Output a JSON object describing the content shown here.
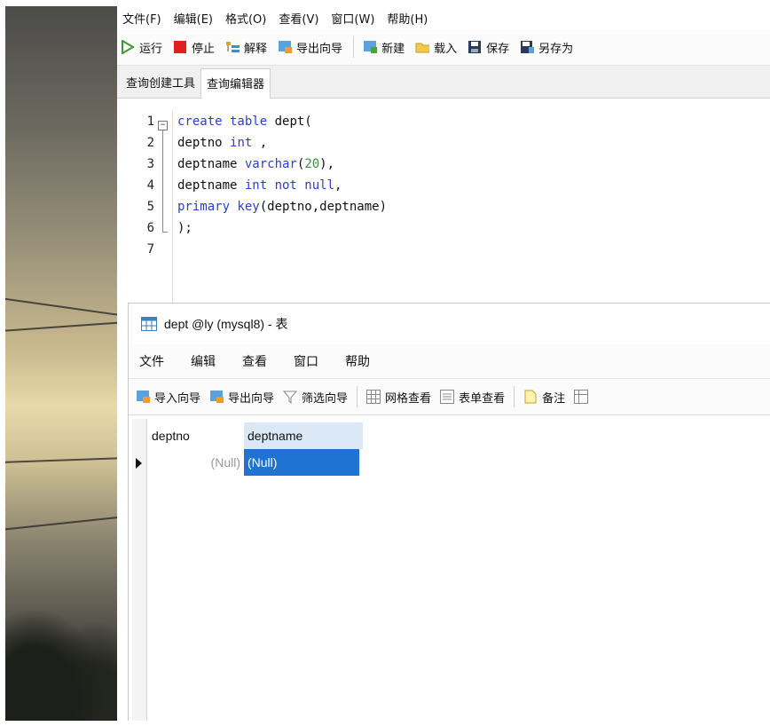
{
  "menubar": [
    "文件(F)",
    "编辑(E)",
    "格式(O)",
    "查看(V)",
    "窗口(W)",
    "帮助(H)"
  ],
  "toolbar": {
    "run": "运行",
    "stop": "停止",
    "explain": "解释",
    "export": "导出向导",
    "new": "新建",
    "load": "载入",
    "save": "保存",
    "save_as": "另存为"
  },
  "tabs": [
    "查询创建工具",
    "查询编辑器"
  ],
  "editor": {
    "line_numbers": [
      "1",
      "2",
      "3",
      "4",
      "5",
      "6",
      "7"
    ],
    "lines": [
      {
        "a": "create table",
        "b": " dept("
      },
      {
        "a": "deptno ",
        "k": "int",
        "b": " ,"
      },
      {
        "a": "deptname ",
        "k": "varchar",
        "b": "(",
        "n": "20",
        "c": "),"
      },
      {
        "a": "deptname ",
        "k": "int not null",
        "b": ","
      },
      {
        "k": "primary key",
        "b": "(deptno,deptname)"
      },
      {
        "b": ");"
      }
    ]
  },
  "table_window": {
    "title": "dept @ly (mysql8) - 表",
    "menu": [
      "文件",
      "编辑",
      "查看",
      "窗口",
      "帮助"
    ],
    "toolbar": {
      "import": "导入向导",
      "export": "导出向导",
      "filter": "筛选向导",
      "grid_view": "网格查看",
      "form_view": "表单查看",
      "memo": "备注"
    },
    "columns": [
      "deptno",
      "deptname"
    ],
    "rows": [
      [
        "(Null)",
        "(Null)"
      ]
    ]
  },
  "colors": {
    "selected_cell": "#1f73d2",
    "selected_header": "#dbe9f6",
    "keyword": "#2a3fd1",
    "number": "#2b9a2b"
  }
}
